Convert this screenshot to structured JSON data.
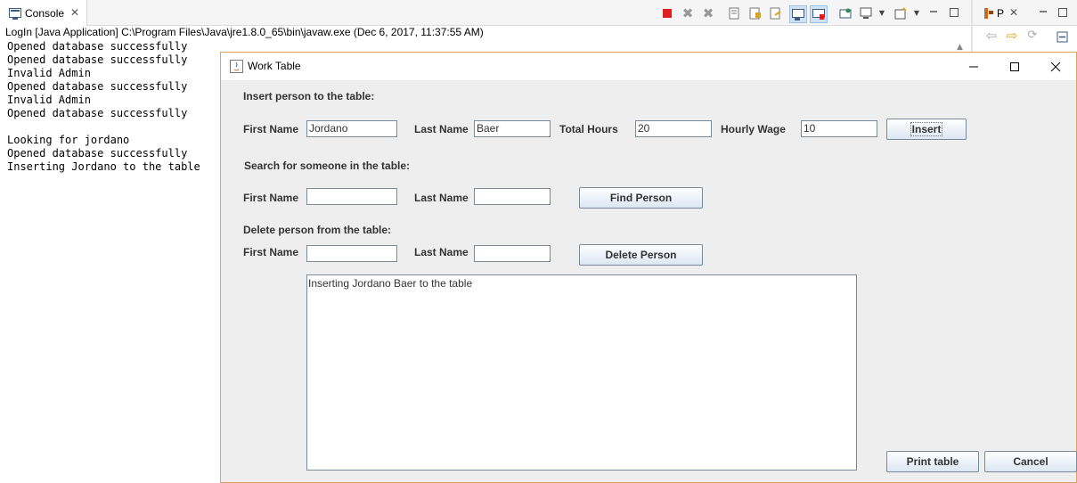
{
  "eclipse": {
    "console_tab_label": "Console",
    "run_info": "LogIn [Java Application] C:\\Program Files\\Java\\jre1.8.0_65\\bin\\javaw.exe (Dec 6, 2017, 11:37:55 AM)",
    "console_lines": [
      "Opened database successfully",
      "Opened database successfully",
      "Invalid Admin",
      "Opened database successfully",
      "Invalid Admin",
      "Opened database successfully",
      "",
      "Looking for jordano",
      "Opened database successfully",
      "Inserting Jordano to the table"
    ],
    "right_tab_label": "P"
  },
  "dialog": {
    "title": "Work Table",
    "insert_section": {
      "heading": "Insert person to the table:",
      "first_name_label": "First Name",
      "first_name_value": "Jordano",
      "last_name_label": "Last Name",
      "last_name_value": "Baer",
      "total_hours_label": "Total Hours",
      "total_hours_value": "20",
      "hourly_wage_label": "Hourly Wage",
      "hourly_wage_value": "10",
      "insert_button": "Insert"
    },
    "search_section": {
      "heading": "Search for someone in the table:",
      "first_name_label": "First Name",
      "first_name_value": "",
      "last_name_label": "Last Name",
      "last_name_value": "",
      "find_button": "Find Person"
    },
    "delete_section": {
      "heading": "Delete person from the table:",
      "first_name_label": "First Name",
      "first_name_value": "",
      "last_name_label": "Last Name",
      "last_name_value": "",
      "delete_button": "Delete Person"
    },
    "output_text": "Inserting Jordano Baer to the table",
    "print_button": "Print table",
    "cancel_button": "Cancel"
  },
  "colors": {
    "dialog_border": "#e0a05a",
    "terminate_red": "#e02020",
    "button_gradient_bottom": "#dce6f2"
  }
}
